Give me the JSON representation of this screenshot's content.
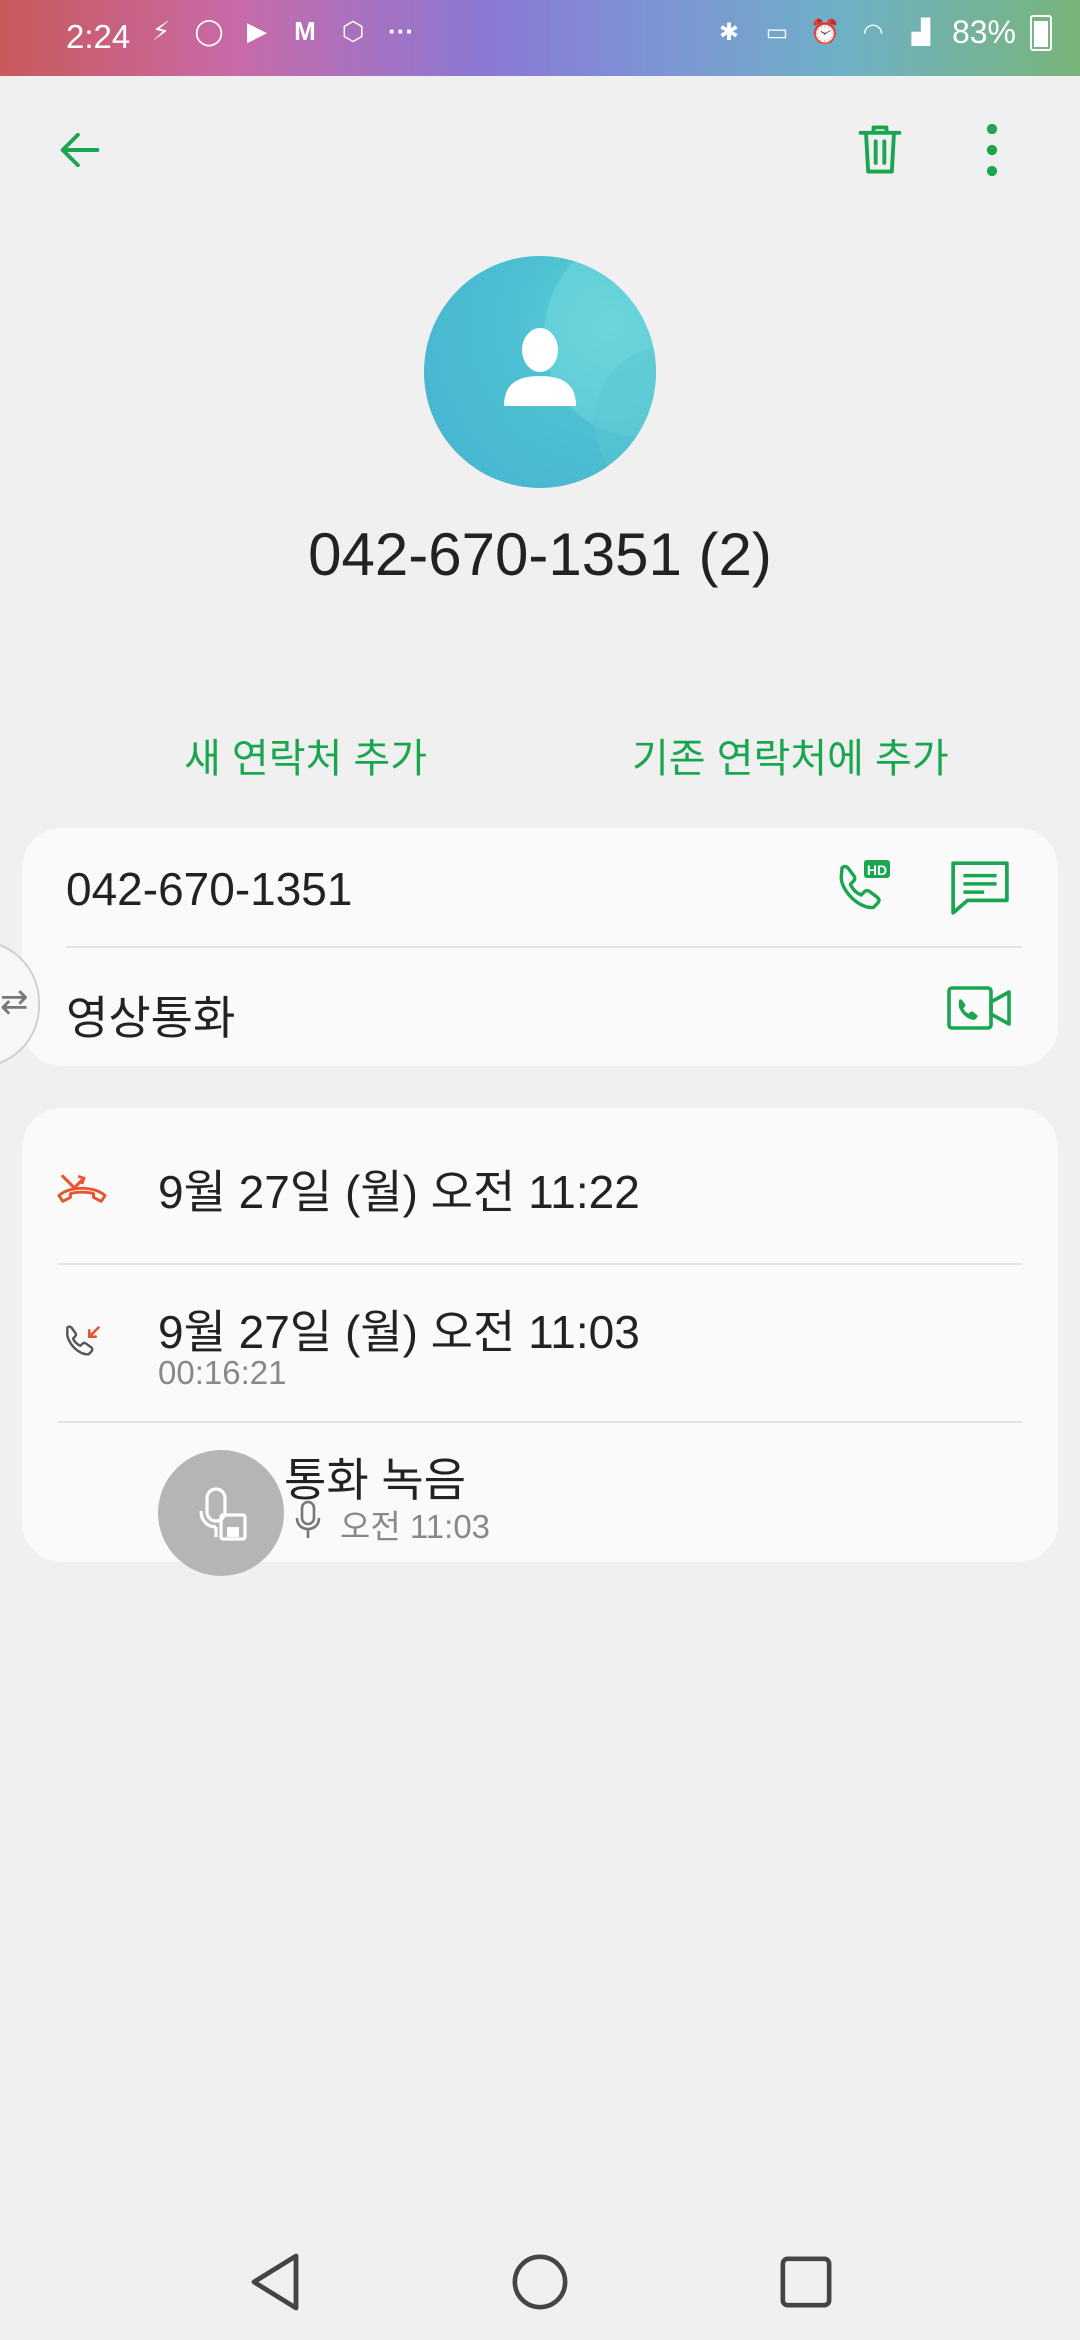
{
  "status_bar": {
    "time": "2:24",
    "left_icons": [
      "K-app-icon",
      "whatsapp-icon",
      "play-icon",
      "gmail-icon",
      "z-app-icon",
      "more-notifications-icon"
    ],
    "right_icons": [
      "bluetooth-icon",
      "nfc-icon",
      "alarm-icon",
      "wifi-icon",
      "signal-icon"
    ],
    "battery": "83%"
  },
  "header": {
    "back_icon": "arrow-left-icon",
    "delete_icon": "trash-icon",
    "more_icon": "more-vert-icon"
  },
  "contact": {
    "title": "042-670-1351 (2)",
    "avatar_icon": "person-icon"
  },
  "actions": {
    "add_new": "새 연락처 추가",
    "add_existing": "기존 연락처에 추가"
  },
  "number_card": {
    "phone": "042-670-1351",
    "video_call": "영상통화",
    "hd_call_icon": "hd-call-icon",
    "message_icon": "message-icon",
    "video_icon": "video-call-icon"
  },
  "call_log": [
    {
      "type": "missed-call-icon",
      "datetime": "9월 27일 (월) 오전 11:22",
      "duration": ""
    },
    {
      "type": "incoming-call-icon",
      "datetime": "9월 27일 (월) 오전 11:03",
      "duration": "00:16:21"
    }
  ],
  "recording": {
    "title": "통화 녹음",
    "time": "오전 11:03",
    "icon": "call-recording-icon",
    "mic_icon": "mic-icon"
  },
  "colors": {
    "accent": "#1aa650",
    "missed": "#e8542d",
    "avatar": "#4cc0d2"
  }
}
